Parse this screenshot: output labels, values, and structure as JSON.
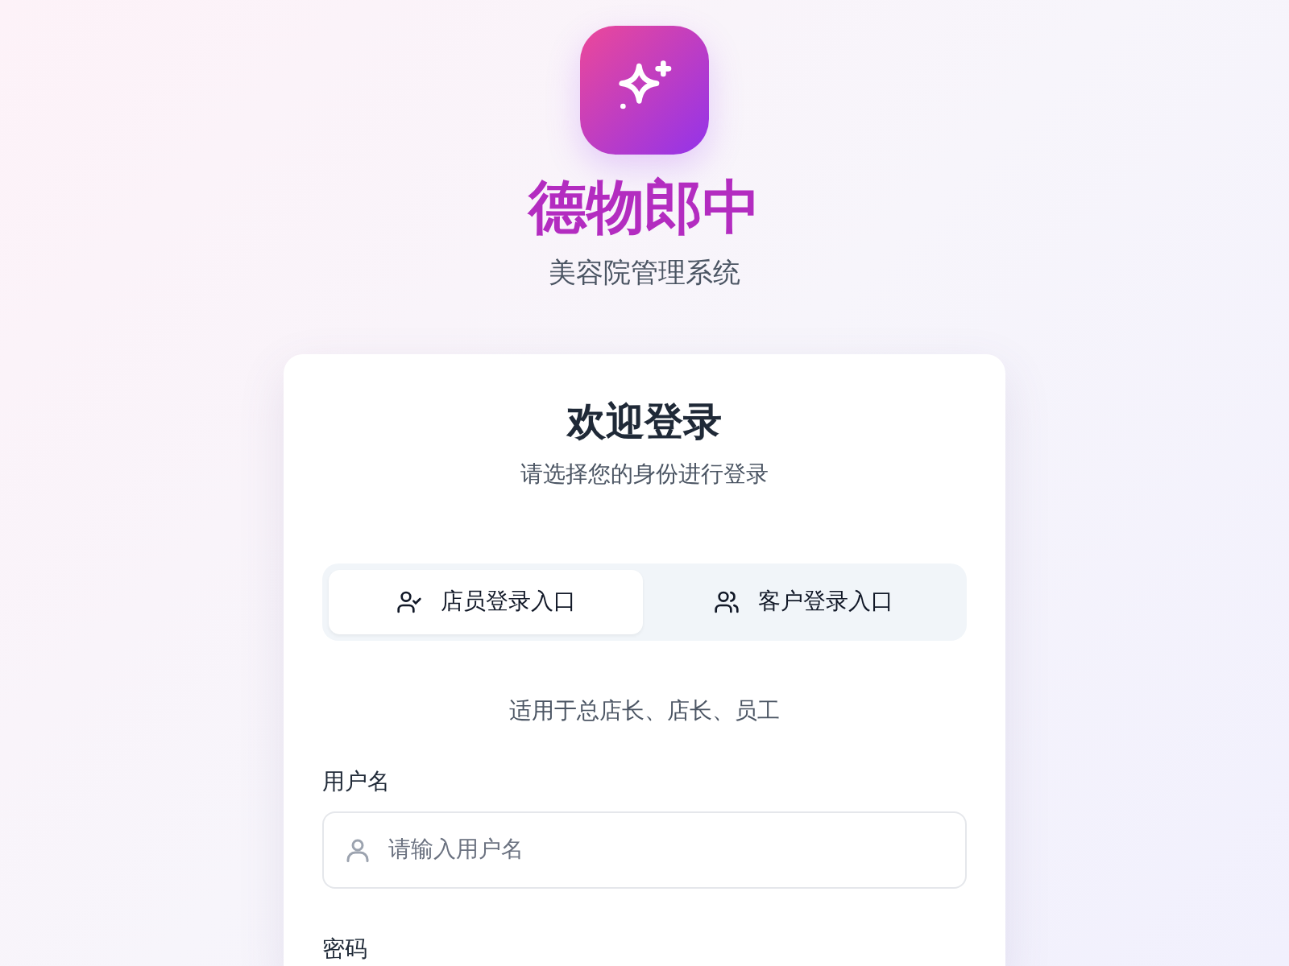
{
  "brand": {
    "name": "德物郎中",
    "subtitle": "美容院管理系统"
  },
  "login": {
    "title": "欢迎登录",
    "subtitle": "请选择您的身份进行登录",
    "tabs": [
      {
        "label": "店员登录入口",
        "kind": "staff",
        "selected": true
      },
      {
        "label": "客户登录入口",
        "kind": "customer",
        "selected": false
      }
    ],
    "hint": "适用于总店长、店长、员工",
    "fields": [
      {
        "label": "用户名",
        "placeholder": "请输入用户名",
        "kind": "user"
      },
      {
        "label": "密码"
      }
    ]
  }
}
